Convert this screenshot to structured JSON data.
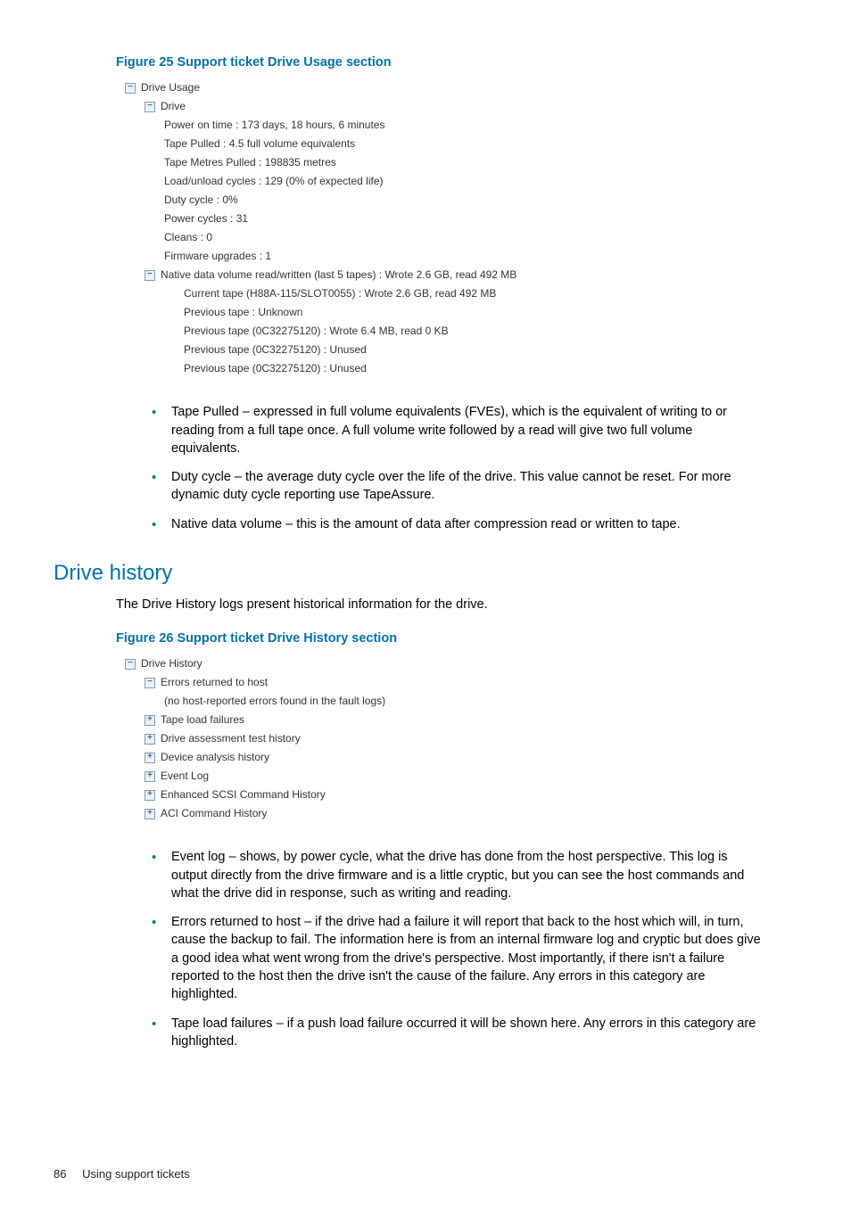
{
  "figure25": {
    "caption": "Figure 25 Support ticket Drive Usage section",
    "tree": {
      "root": "Drive Usage",
      "drive_label": "Drive",
      "items": [
        "Power on time : 173 days, 18 hours, 6 minutes",
        "Tape Pulled : 4.5 full volume equivalents",
        "Tape Metres Pulled : 198835 metres",
        "Load/unload cycles : 129 (0% of expected life)",
        "Duty cycle : 0%",
        "Power cycles : 31",
        "Cleans : 0",
        "Firmware upgrades : 1"
      ],
      "native_label": "Native data volume read/written (last 5 tapes) : Wrote 2.6 GB, read 492 MB",
      "native_items": [
        "Current tape (H88A-115/SLOT0055) : Wrote 2.6 GB, read 492 MB",
        "Previous tape : Unknown",
        "Previous tape (0C32275120) : Wrote 6.4 MB, read 0 KB",
        "Previous tape (0C32275120) : Unused",
        "Previous tape (0C32275120) : Unused"
      ]
    }
  },
  "bullets1": [
    "Tape Pulled – expressed in full volume equivalents (FVEs), which is the equivalent of writing to or reading from a full tape once. A full volume write followed by a read will give two full volume equivalents.",
    "Duty cycle – the average duty cycle over the life of the drive. This value cannot be reset. For more dynamic duty cycle reporting use TapeAssure.",
    "Native data volume – this is the amount of data after compression read or written to tape."
  ],
  "section2": {
    "heading": "Drive history",
    "intro": "The Drive History logs present historical information for the drive."
  },
  "figure26": {
    "caption": "Figure 26 Support ticket Drive History section",
    "tree": {
      "root": "Drive History",
      "errors_label": "Errors returned to host",
      "errors_note": "(no host-reported errors found in the fault logs)",
      "plus_items": [
        "Tape load failures",
        "Drive assessment test history",
        "Device analysis history",
        "Event Log",
        "Enhanced SCSI Command History",
        "ACI Command History"
      ]
    }
  },
  "bullets2": [
    "Event log – shows, by power cycle, what the drive has done from the host perspective. This log is output directly from the drive firmware and is a little cryptic, but you can see the host commands and what the drive did in response, such as writing and reading.",
    "Errors returned to host – if the drive had a failure it will report that back to the host which will, in turn, cause the backup to fail. The information here is from an internal firmware log and cryptic but does give a good idea what went wrong from the drive's perspective. Most importantly, if there isn't a failure reported to the host then the drive isn't the cause of the failure. Any errors in this category are highlighted.",
    "Tape load failures – if a push load failure occurred it will be shown here. Any errors in this category are highlighted."
  ],
  "footer": {
    "page": "86",
    "title": "Using support tickets"
  },
  "icons": {
    "minus": "−",
    "plus": "+"
  }
}
